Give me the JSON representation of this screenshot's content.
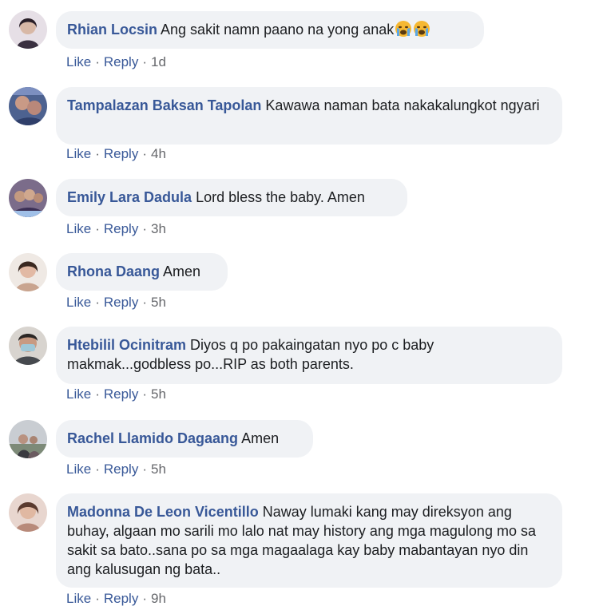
{
  "comments": [
    {
      "author": "Rhian Locsin",
      "text": "Ang sakit namn paano na yong anak",
      "emojis": [
        "crying-face",
        "crying-face"
      ],
      "like": "Like",
      "reply": "Reply",
      "time": "1d",
      "avatar_color": "#3a3040"
    },
    {
      "author": "Tampalazan Baksan Tapolan",
      "text": "Kawawa naman bata nakakalungkot ngyari",
      "like": "Like",
      "reply": "Reply",
      "time": "4h",
      "avatar_color": "#5a6f95"
    },
    {
      "author": "Emily Lara Dadula",
      "text": "Lord bless the baby. Amen",
      "like": "Like",
      "reply": "Reply",
      "time": "3h",
      "avatar_color": "#6a5a7a"
    },
    {
      "author": "Rhona Daang",
      "text": "Amen",
      "like": "Like",
      "reply": "Reply",
      "time": "5h",
      "avatar_color": "#c9a48f"
    },
    {
      "author": "Htebilil Ocinitram",
      "text": "Diyos q po pakaingatan nyo po c baby makmak...godbless po...RIP as both parents.",
      "like": "Like",
      "reply": "Reply",
      "time": "5h",
      "avatar_color": "#6f7378"
    },
    {
      "author": "Rachel Llamido Dagaang",
      "text": "Amen",
      "like": "Like",
      "reply": "Reply",
      "time": "5h",
      "avatar_color": "#8a8f95"
    },
    {
      "author": "Madonna De Leon Vicentillo",
      "text": "Naway lumaki kang may direksyon ang buhay, algaan mo sarili mo lalo nat may history ang mga magulong mo sa sakit sa bato..sana po sa mga magaalaga kay baby mabantayan nyo din ang kalusugan ng bata..",
      "like": "Like",
      "reply": "Reply",
      "time": "9h",
      "avatar_color": "#b88a7a"
    }
  ],
  "separator": "·"
}
